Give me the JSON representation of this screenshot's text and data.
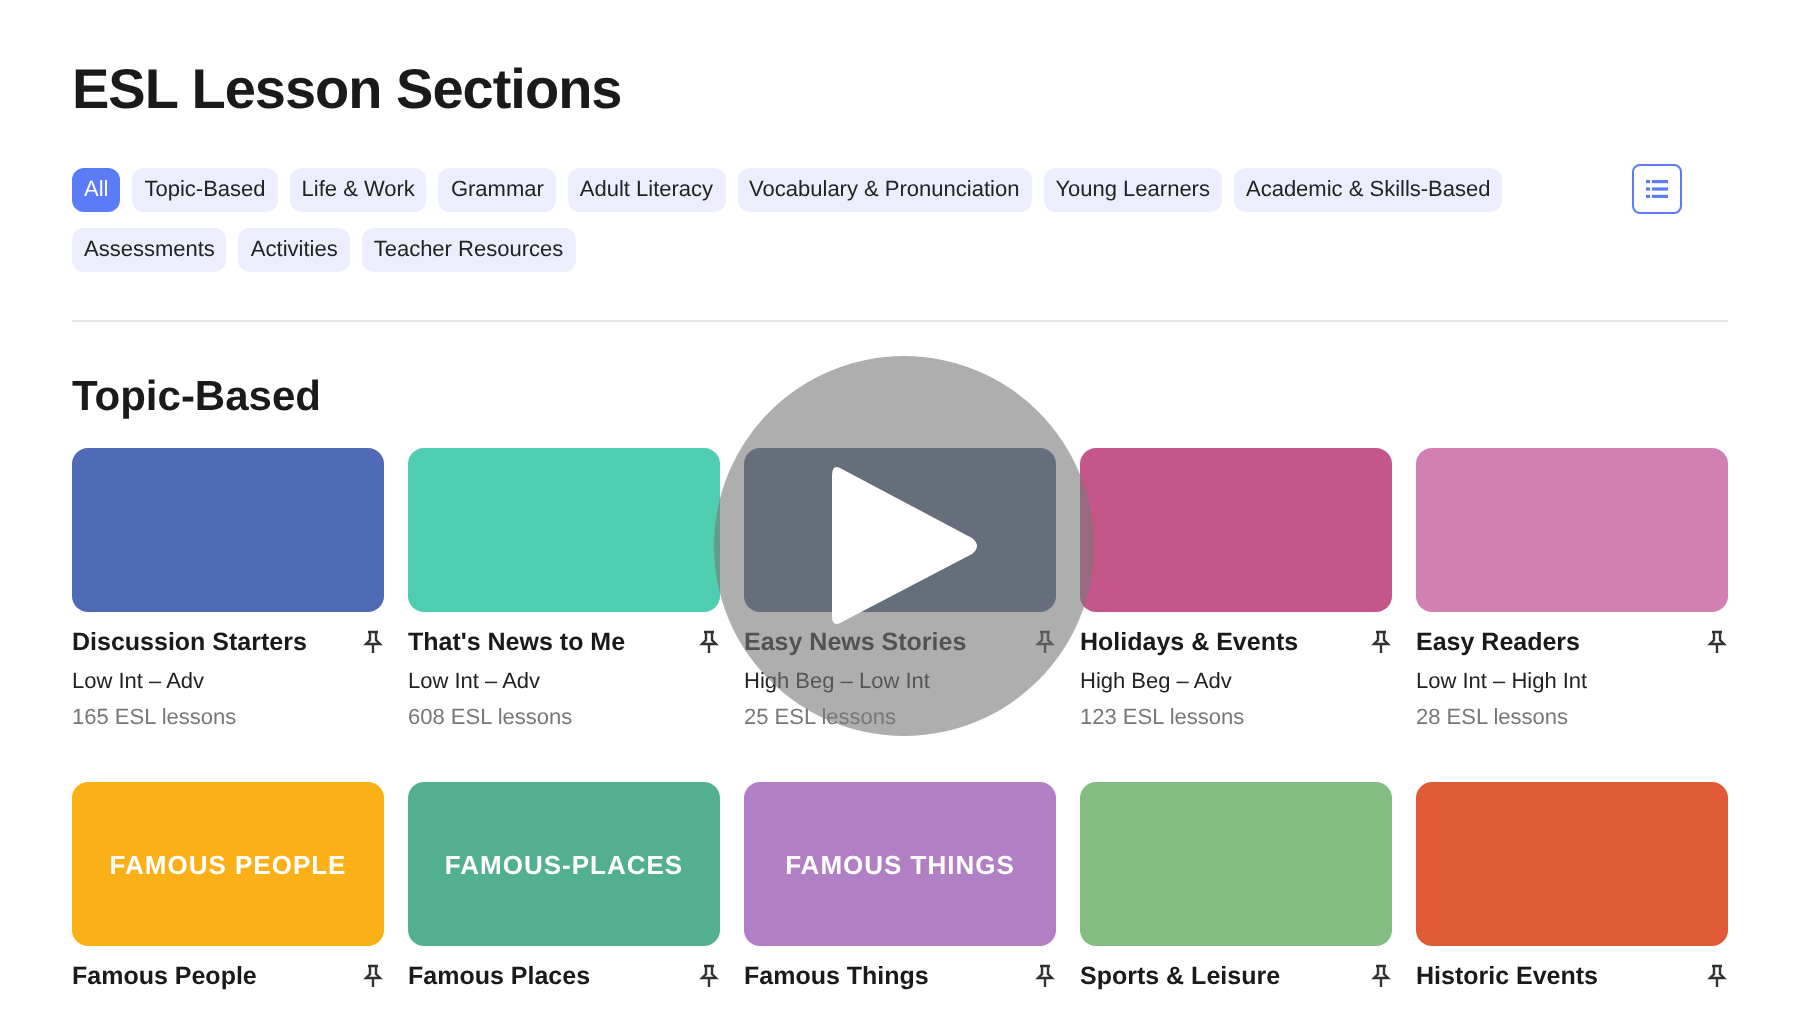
{
  "page_title": "ESL Lesson Sections",
  "filters": [
    {
      "label": "All",
      "selected": true
    },
    {
      "label": "Topic-Based",
      "selected": false
    },
    {
      "label": "Life & Work",
      "selected": false
    },
    {
      "label": "Grammar",
      "selected": false
    },
    {
      "label": "Adult Literacy",
      "selected": false
    },
    {
      "label": "Vocabulary & Pronunciation",
      "selected": false
    },
    {
      "label": "Young Learners",
      "selected": false
    },
    {
      "label": "Academic & Skills-Based",
      "selected": false
    },
    {
      "label": "Assessments",
      "selected": false
    },
    {
      "label": "Activities",
      "selected": false
    },
    {
      "label": "Teacher Resources",
      "selected": false
    }
  ],
  "section": {
    "title": "Topic-Based",
    "cards": [
      {
        "title": "Discussion Starters",
        "level_range": "Low Int – Adv",
        "count": "165 ESL lessons"
      },
      {
        "title": "That's News to Me",
        "level_range": "Low Int – Adv",
        "count": "608 ESL lessons"
      },
      {
        "title": "Easy News Stories",
        "level_range": "High Beg – Low Int",
        "count": "25 ESL lessons"
      },
      {
        "title": "Holidays & Events",
        "level_range": "High Beg – Adv",
        "count": "123 ESL lessons"
      },
      {
        "title": "Easy Readers",
        "level_range": "Low Int – High Int",
        "count": "28 ESL lessons"
      },
      {
        "title": "Famous People",
        "banner_text": "FAMOUS PEOPLE"
      },
      {
        "title": "Famous Places",
        "banner_text": "FAMOUS-PLACES"
      },
      {
        "title": "Famous Things",
        "banner_text": "FAMOUS THINGS"
      },
      {
        "title": "Sports & Leisure"
      },
      {
        "title": "Historic Events"
      }
    ]
  }
}
